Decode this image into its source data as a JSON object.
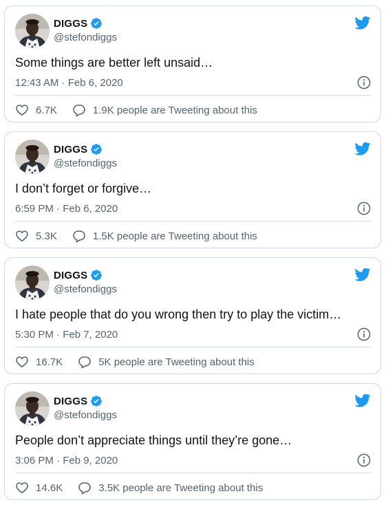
{
  "colors": {
    "verified_blue": "#1d9bf0",
    "twitter_blue": "#1d9bf0",
    "secondary_text": "#536471",
    "border": "#cfd9de"
  },
  "icons": {
    "verified": "verified-badge-icon",
    "brand": "twitter-bird-icon",
    "info": "info-icon",
    "like": "heart-icon",
    "reply": "speech-bubble-icon"
  },
  "tweets": [
    {
      "author": {
        "display_name": "DIGGS",
        "handle": "@stefondiggs"
      },
      "text": "Some things are better left unsaid…",
      "timestamp": "12:43 AM · Feb 6, 2020",
      "likes": "6.7K",
      "tweeting_about": "1.9K people are Tweeting about this"
    },
    {
      "author": {
        "display_name": "DIGGS",
        "handle": "@stefondiggs"
      },
      "text": "I don’t forget or forgive…",
      "timestamp": "6:59 PM · Feb 6, 2020",
      "likes": "5.3K",
      "tweeting_about": "1.5K people are Tweeting about this"
    },
    {
      "author": {
        "display_name": "DIGGS",
        "handle": "@stefondiggs"
      },
      "text": "I hate people that do you wrong then try to play the victim…",
      "timestamp": "5:30 PM · Feb 7, 2020",
      "likes": "16.7K",
      "tweeting_about": "5K people are Tweeting about this"
    },
    {
      "author": {
        "display_name": "DIGGS",
        "handle": "@stefondiggs"
      },
      "text": "People don’t appreciate things until they’re gone…",
      "timestamp": "3:06 PM · Feb 9, 2020",
      "likes": "14.6K",
      "tweeting_about": "3.5K people are Tweeting about this"
    }
  ]
}
